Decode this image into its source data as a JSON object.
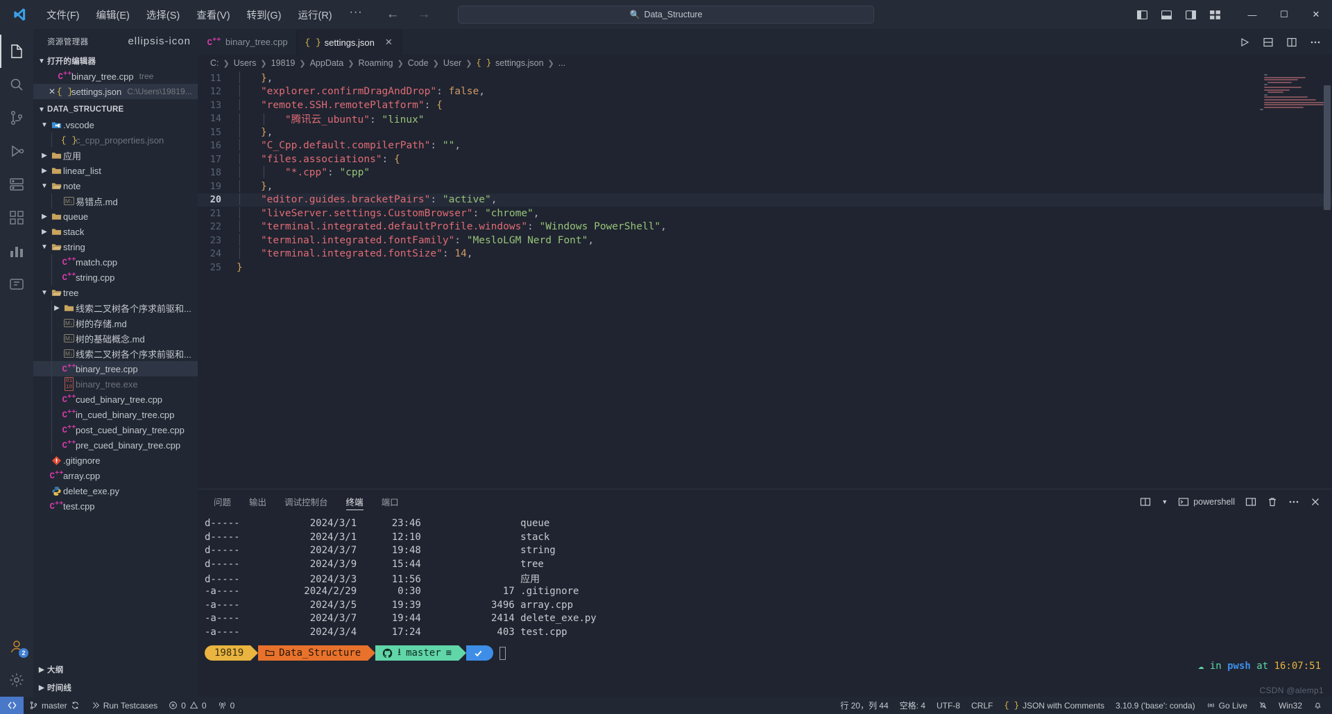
{
  "titlebar": {
    "logo_icon": "vscode-logo-icon",
    "menus": [
      "文件(F)",
      "编辑(E)",
      "选择(S)",
      "查看(V)",
      "转到(G)",
      "运行(R)"
    ],
    "more_label": "···",
    "back_icon": "arrow-left-icon",
    "forward_icon": "arrow-right-icon",
    "command_center": {
      "text": "Data_Structure",
      "search_icon": "search-icon"
    },
    "layout_icons": [
      "toggle-primary-sidebar-icon",
      "toggle-panel-icon",
      "toggle-secondary-sidebar-icon",
      "customize-layout-icon"
    ],
    "window_controls": {
      "minimize": "—",
      "maximize": "☐",
      "close": "✕"
    }
  },
  "activitybar": {
    "items": [
      {
        "name": "explorer",
        "icon": "files-icon",
        "active": true
      },
      {
        "name": "search",
        "icon": "search-icon",
        "active": false
      },
      {
        "name": "source-control",
        "icon": "source-control-icon",
        "active": false
      },
      {
        "name": "run-and-debug",
        "icon": "debug-icon",
        "active": false
      },
      {
        "name": "remote-explorer",
        "icon": "remote-explorer-icon",
        "active": false
      },
      {
        "name": "extensions",
        "icon": "extensions-icon",
        "active": false
      },
      {
        "name": "testing",
        "icon": "beaker-chart-icon",
        "active": false
      },
      {
        "name": "docker",
        "icon": "docker-icon",
        "active": false
      }
    ],
    "bottom": [
      {
        "name": "accounts",
        "icon": "account-icon",
        "badge": "2"
      },
      {
        "name": "manage",
        "icon": "gear-icon",
        "badge": ""
      }
    ]
  },
  "sidebar": {
    "title": "资源管理器",
    "more_icon": "ellipsis-icon",
    "open_editors": {
      "label": "打开的编辑器",
      "items": [
        {
          "icon": "cpp-file-icon",
          "label": "binary_tree.cpp",
          "sub": "tree",
          "closable": false,
          "selected": false
        },
        {
          "icon": "json-file-icon",
          "label": "settings.json",
          "sub": "C:\\Users\\19819...",
          "closable": true,
          "selected": true
        }
      ]
    },
    "workspace": {
      "label": "DATA_STRUCTURE",
      "tree": [
        {
          "depth": 1,
          "type": "folder",
          "state": "open",
          "icon": "vscode-folder-icon",
          "label": ".vscode"
        },
        {
          "depth": 2,
          "type": "file",
          "icon": "json-file-icon",
          "label": "c_cpp_properties.json",
          "dim": true
        },
        {
          "depth": 1,
          "type": "folder",
          "state": "closed",
          "icon": "folder-icon",
          "label": "应用"
        },
        {
          "depth": 1,
          "type": "folder",
          "state": "closed",
          "icon": "folder-icon",
          "label": "linear_list"
        },
        {
          "depth": 1,
          "type": "folder",
          "state": "open",
          "icon": "folder-icon",
          "label": "note"
        },
        {
          "depth": 2,
          "type": "file",
          "icon": "markdown-file-icon",
          "label": "易错点.md"
        },
        {
          "depth": 1,
          "type": "folder",
          "state": "closed",
          "icon": "folder-icon",
          "label": "queue"
        },
        {
          "depth": 1,
          "type": "folder",
          "state": "closed",
          "icon": "folder-icon",
          "label": "stack"
        },
        {
          "depth": 1,
          "type": "folder",
          "state": "open",
          "icon": "folder-icon",
          "label": "string"
        },
        {
          "depth": 2,
          "type": "file",
          "icon": "cpp-file-icon",
          "label": "match.cpp"
        },
        {
          "depth": 2,
          "type": "file",
          "icon": "cpp-file-icon",
          "label": "string.cpp"
        },
        {
          "depth": 1,
          "type": "folder",
          "state": "open",
          "icon": "folder-icon",
          "label": "tree"
        },
        {
          "depth": 2,
          "type": "folder",
          "state": "closed",
          "icon": "folder-icon",
          "label": "线索二叉树各个序求前驱和..."
        },
        {
          "depth": 2,
          "type": "file",
          "icon": "markdown-file-icon",
          "label": "树的存储.md"
        },
        {
          "depth": 2,
          "type": "file",
          "icon": "markdown-file-icon",
          "label": "树的基础概念.md"
        },
        {
          "depth": 2,
          "type": "file",
          "icon": "markdown-file-icon",
          "label": "线索二叉树各个序求前驱和..."
        },
        {
          "depth": 2,
          "type": "file",
          "icon": "cpp-file-icon",
          "label": "binary_tree.cpp",
          "selected": true
        },
        {
          "depth": 2,
          "type": "file",
          "icon": "binary-file-icon",
          "label": "binary_tree.exe",
          "dim": true
        },
        {
          "depth": 2,
          "type": "file",
          "icon": "cpp-file-icon",
          "label": "cued_binary_tree.cpp"
        },
        {
          "depth": 2,
          "type": "file",
          "icon": "cpp-file-icon",
          "label": "in_cued_binary_tree.cpp"
        },
        {
          "depth": 2,
          "type": "file",
          "icon": "cpp-file-icon",
          "label": "post_cued_binary_tree.cpp"
        },
        {
          "depth": 2,
          "type": "file",
          "icon": "cpp-file-icon",
          "label": "pre_cued_binary_tree.cpp"
        },
        {
          "depth": 1,
          "type": "file",
          "icon": "git-file-icon",
          "label": ".gitignore"
        },
        {
          "depth": 1,
          "type": "file",
          "icon": "cpp-file-icon",
          "label": "array.cpp"
        },
        {
          "depth": 1,
          "type": "file",
          "icon": "python-file-icon",
          "label": "delete_exe.py"
        },
        {
          "depth": 1,
          "type": "file",
          "icon": "cpp-file-icon",
          "label": "test.cpp"
        }
      ]
    },
    "collapsed_sections": [
      {
        "label": "大纲",
        "icon": "chevron-right-icon"
      },
      {
        "label": "时间线",
        "icon": "chevron-right-icon"
      }
    ]
  },
  "tabs": [
    {
      "icon": "cpp-file-icon",
      "label": "binary_tree.cpp",
      "active": false,
      "closable": false
    },
    {
      "icon": "json-file-icon",
      "label": "settings.json",
      "active": true,
      "closable": true,
      "close_icon": "close-icon"
    }
  ],
  "tab_actions": [
    "run-icon",
    "split-editor-down-icon",
    "split-editor-right-icon",
    "more-actions-icon"
  ],
  "breadcrumb": [
    "C:",
    "Users",
    "19819",
    "AppData",
    "Roaming",
    "Code",
    "User",
    "settings.json",
    "..."
  ],
  "editor": {
    "language_icon": "json-file-icon",
    "first_line_number": 11,
    "lines": [
      {
        "n": 11,
        "text": "    },",
        "highlight": false
      },
      {
        "n": 12,
        "text": "    \"explorer.confirmDragAndDrop\": false,",
        "highlight": false
      },
      {
        "n": 13,
        "text": "    \"remote.SSH.remotePlatform\": {",
        "highlight": false
      },
      {
        "n": 14,
        "text": "        \"腾讯云_ubuntu\": \"linux\"",
        "highlight": false
      },
      {
        "n": 15,
        "text": "    },",
        "highlight": false
      },
      {
        "n": 16,
        "text": "    \"C_Cpp.default.compilerPath\": \"\",",
        "highlight": false
      },
      {
        "n": 17,
        "text": "    \"files.associations\": {",
        "highlight": false
      },
      {
        "n": 18,
        "text": "        \"*.cpp\": \"cpp\"",
        "highlight": false
      },
      {
        "n": 19,
        "text": "    },",
        "highlight": false
      },
      {
        "n": 20,
        "text": "    \"editor.guides.bracketPairs\": \"active\",",
        "highlight": true
      },
      {
        "n": 21,
        "text": "    \"liveServer.settings.CustomBrowser\": \"chrome\",",
        "highlight": false
      },
      {
        "n": 22,
        "text": "    \"terminal.integrated.defaultProfile.windows\": \"Windows PowerShell\",",
        "highlight": false
      },
      {
        "n": 23,
        "text": "    \"terminal.integrated.fontFamily\": \"MesloLGM Nerd Font\",",
        "highlight": false
      },
      {
        "n": 24,
        "text": "    \"terminal.integrated.fontSize\": 14,",
        "highlight": false
      },
      {
        "n": 25,
        "text": "}",
        "highlight": false
      }
    ]
  },
  "panel": {
    "tabs": [
      "问题",
      "输出",
      "调试控制台",
      "终端",
      "端口"
    ],
    "active_tab": "终端",
    "actions": {
      "split_icon": "split-terminal-icon",
      "chevron_icon": "chevron-down-icon",
      "new_terminal_icon": "new-terminal-icon",
      "shell_name": "powershell",
      "layout_icon": "layout-terminal-icon",
      "kill_icon": "trash-icon",
      "more_icon": "ellipsis-icon",
      "close_icon": "close-icon"
    },
    "terminal_rows": [
      {
        "mode": "d-----",
        "date": "2024/3/1",
        "time": "23:46",
        "size": "",
        "name": "queue"
      },
      {
        "mode": "d-----",
        "date": "2024/3/1",
        "time": "12:10",
        "size": "",
        "name": "stack"
      },
      {
        "mode": "d-----",
        "date": "2024/3/7",
        "time": "19:48",
        "size": "",
        "name": "string"
      },
      {
        "mode": "d-----",
        "date": "2024/3/9",
        "time": "15:44",
        "size": "",
        "name": "tree"
      },
      {
        "mode": "d-----",
        "date": "2024/3/3",
        "time": "11:56",
        "size": "",
        "name": "应用"
      },
      {
        "mode": "-a----",
        "date": "2024/2/29",
        "time": "0:30",
        "size": "17",
        "name": ".gitignore"
      },
      {
        "mode": "-a----",
        "date": "2024/3/5",
        "time": "19:39",
        "size": "3496",
        "name": "array.cpp"
      },
      {
        "mode": "-a----",
        "date": "2024/3/7",
        "time": "19:44",
        "size": "2414",
        "name": "delete_exe.py"
      },
      {
        "mode": "-a----",
        "date": "2024/3/4",
        "time": "17:24",
        "size": "403",
        "name": "test.cpp"
      }
    ],
    "prompt": {
      "user_segment": "19819",
      "folder_icon": "folder-icon",
      "folder_segment": "Data_Structure",
      "git_icon": "github-icon",
      "branch_icon": "branch-icon",
      "branch_segment": "master",
      "branch_status_icon": "≡",
      "status_icon": "check-icon",
      "cursor": "block-cursor"
    },
    "right_status": {
      "in": "in",
      "shell": "pwsh",
      "at": "at",
      "time": "16:07:51"
    },
    "watermark": "CSDN @alemp1"
  },
  "statusbar": {
    "remote_icon": "remote-indicator-icon",
    "left": [
      {
        "icon": "source-control-icon",
        "label": "master",
        "extra_icon": "sync-icon"
      },
      {
        "icon": "play-icon",
        "label": "Run Testcases"
      },
      {
        "icon": "error-icon",
        "label": "0",
        "icon2": "warning-icon",
        "label2": "0"
      },
      {
        "icon": "radio-tower-icon",
        "label": "0"
      }
    ],
    "right": [
      {
        "label": "行 20，列 44"
      },
      {
        "label": "空格: 4"
      },
      {
        "label": "UTF-8"
      },
      {
        "label": "CRLF"
      },
      {
        "icon": "json-lang-icon",
        "label": "JSON with Comments"
      },
      {
        "label": "3.10.9 ('base': conda)"
      },
      {
        "icon": "broadcast-icon",
        "label": "Go Live"
      },
      {
        "icon": "bell-slash-icon",
        "label": ""
      },
      {
        "label": "Win32"
      },
      {
        "icon": "bell-icon",
        "label": ""
      }
    ]
  },
  "colors": {
    "accent_blue": "#4a78c8",
    "prompt_user_bg": "#e9b43f",
    "prompt_folder_bg": "#e8722c",
    "prompt_branch_bg": "#61d6a8",
    "prompt_status_bg": "#3e8ee8",
    "cpp_pink": "#d13ba8",
    "json_yellow": "#d8b84a",
    "string_green": "#98c379",
    "key_red": "#e06c75"
  }
}
